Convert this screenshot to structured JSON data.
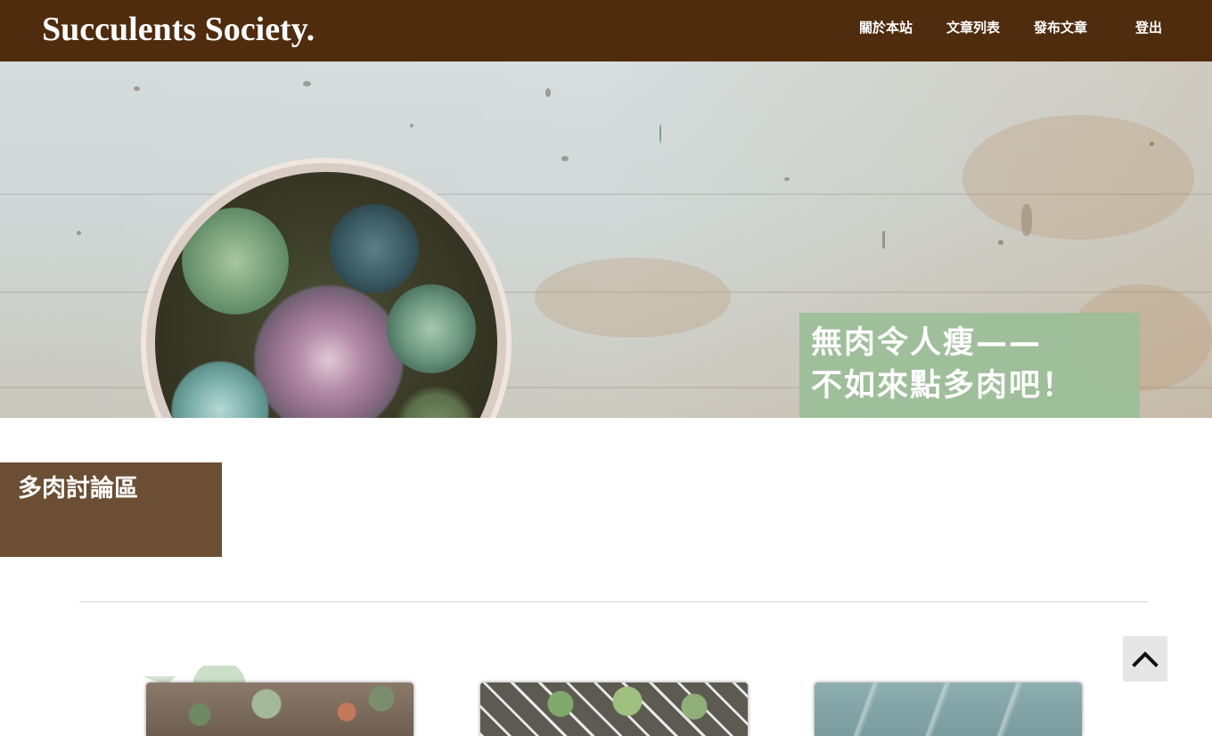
{
  "navbar": {
    "brand": "Succulents Society.",
    "links": [
      "關於本站",
      "文章列表",
      "發布文章",
      "登出"
    ]
  },
  "hero": {
    "caption_line1": "無肉令人瘦——",
    "caption_line2": "不如來點多肉吧！"
  },
  "section": {
    "title": "多肉討論區"
  },
  "cards": [
    {
      "image": "succulent-arrangement-photo"
    },
    {
      "image": "cactus-tray-photo"
    },
    {
      "image": "agave-leaves-photo"
    }
  ],
  "back_to_top": {
    "icon": "chevron-up-icon"
  },
  "colors": {
    "navbar": "#4f2c0e",
    "caption_bg": "#9bbe98",
    "section_bg": "#6b4e33"
  }
}
